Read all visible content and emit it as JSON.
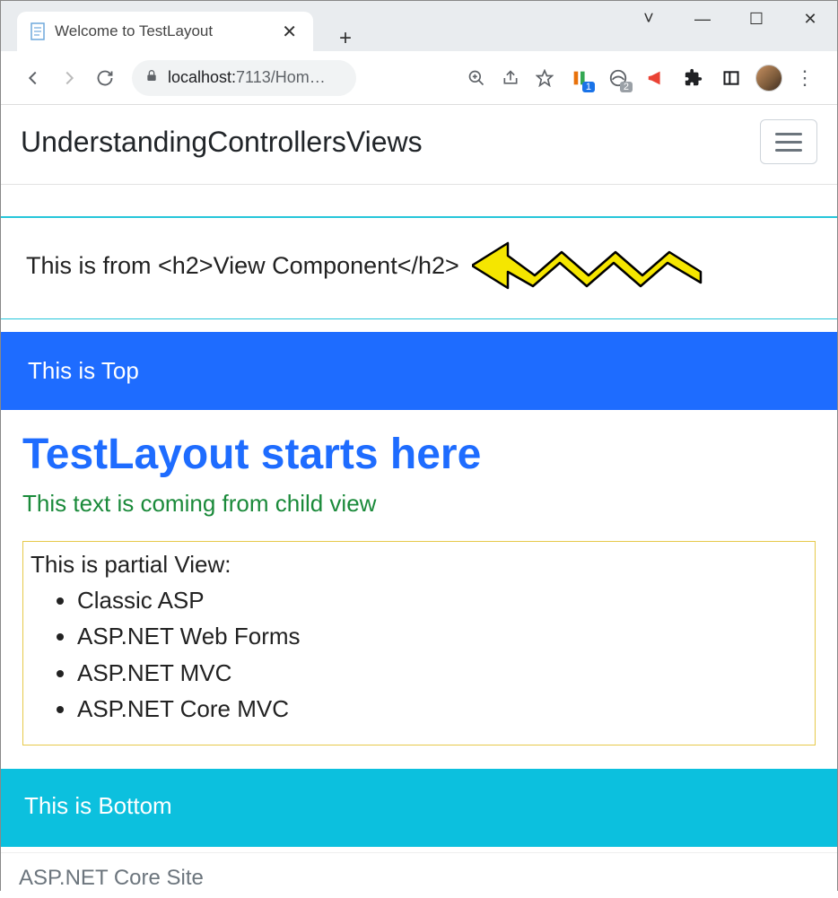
{
  "window": {
    "tab_title": "Welcome to TestLayout",
    "new_tab_symbol": "+",
    "close_tab_symbol": "✕",
    "chevron": "˅",
    "minimize": "—",
    "maximize": "☐",
    "close": "✕"
  },
  "toolbar": {
    "url_host": "localhost:",
    "url_port_path": "7113/Hom…",
    "ext_badge1": "1",
    "ext_badge2": "2",
    "menu_symbol": "⋮"
  },
  "page": {
    "brand": "UnderstandingControllersViews",
    "vc_text": "This is from <h2>View Component</h2>",
    "top_text": "This is Top",
    "heading": "TestLayout starts here",
    "sub_text": "This text is coming from child view",
    "partial_label": "This is partial View:",
    "partial_items": [
      "Classic ASP",
      "ASP.NET Web Forms",
      "ASP.NET MVC",
      "ASP.NET Core MVC"
    ],
    "bottom_text": "This is Bottom",
    "footer": "ASP.NET Core Site"
  }
}
